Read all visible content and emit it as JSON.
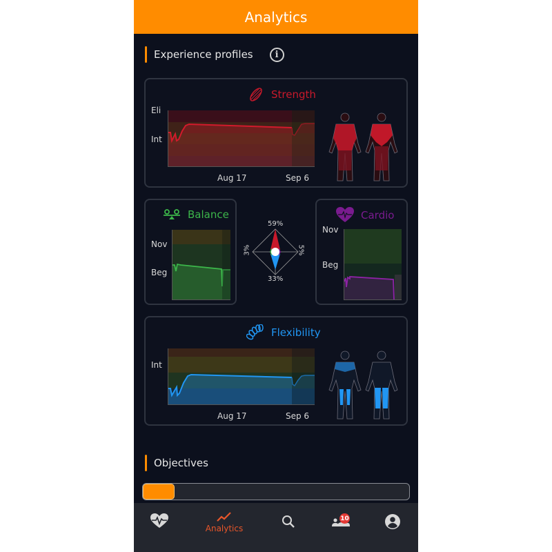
{
  "header": {
    "title": "Analytics"
  },
  "experience": {
    "title": "Experience profiles",
    "info_icon": "info-icon",
    "strength": {
      "label": "Strength",
      "icon": "muscle-icon",
      "color": "#c8192b",
      "y_labels": [
        "Eli",
        "Int"
      ],
      "x_labels": [
        "Aug 17",
        "Sep 6"
      ],
      "highlight": "upper-body-front-and-back"
    },
    "balance": {
      "label": "Balance",
      "icon": "balance-scale-icon",
      "color": "#3cb64a",
      "y_labels": [
        "Nov",
        "Beg"
      ]
    },
    "cardio": {
      "label": "Cardio",
      "icon": "heart-pulse-icon",
      "color": "#7a1b8f",
      "y_labels": [
        "Nov",
        "Beg"
      ]
    },
    "flexibility": {
      "label": "Flexibility",
      "icon": "spring-icon",
      "color": "#2196f3",
      "y_labels": [
        "Int"
      ],
      "x_labels": [
        "Aug 17",
        "Sep 6"
      ],
      "highlight": "chest-thighs-hamstrings"
    },
    "distribution": {
      "top": "59%",
      "bottom": "33%",
      "left": "3%",
      "right": "5%"
    }
  },
  "objectives": {
    "title": "Objectives",
    "progress_percent": 12
  },
  "nav": {
    "items": [
      {
        "name": "health",
        "icon": "heart-pulse-icon",
        "label": ""
      },
      {
        "name": "analytics",
        "icon": "trend-icon",
        "label": "Analytics",
        "active": true
      },
      {
        "name": "search",
        "icon": "search-icon",
        "label": ""
      },
      {
        "name": "community",
        "icon": "group-icon",
        "label": "",
        "badge": "10"
      },
      {
        "name": "profile",
        "icon": "account-icon",
        "label": ""
      }
    ]
  }
}
